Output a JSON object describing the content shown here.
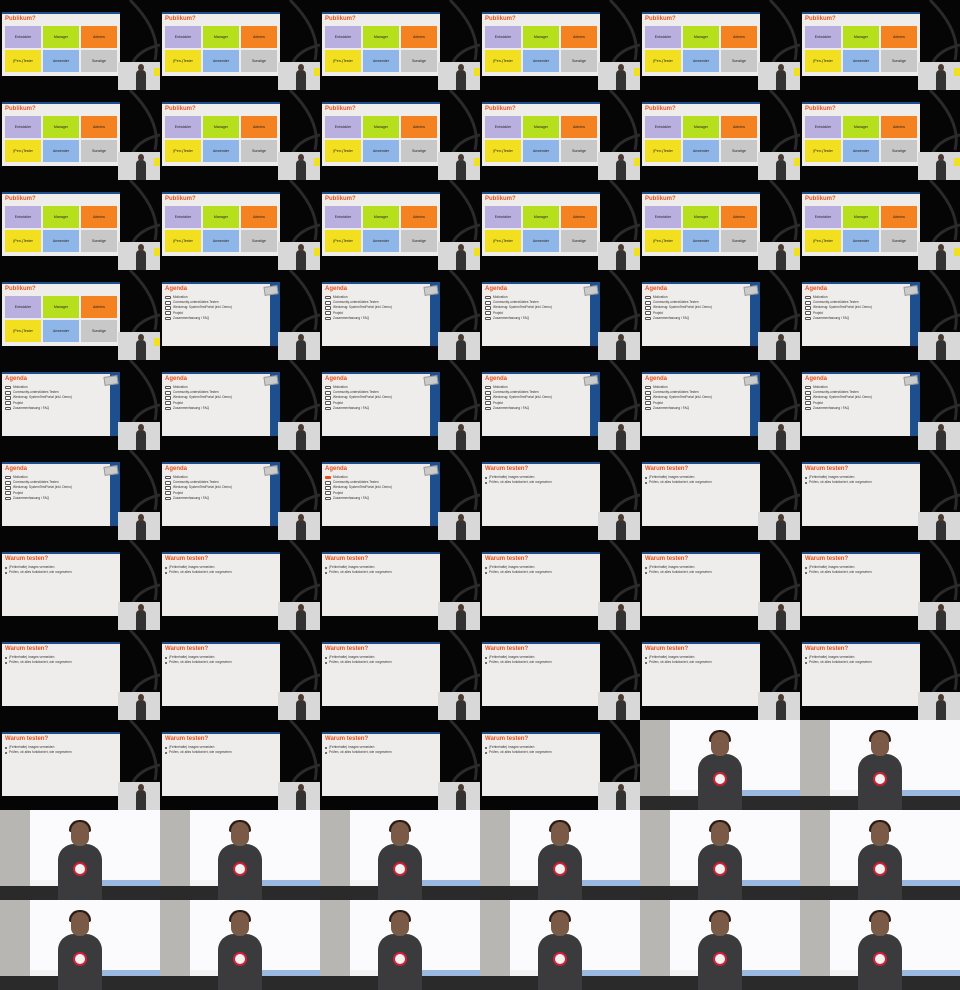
{
  "colors": {
    "accent": "#e8501a",
    "slide_bg": "#eeedeb",
    "brand_blue": "#1c4f8c",
    "tile_entwickler": "#b9b0e0",
    "tile_manager": "#b6e01e",
    "tile_admins": "#f58220",
    "tile_pentester": "#f2e020",
    "tile_anwender": "#8fb6e8",
    "tile_sonstige": "#c8c8c8"
  },
  "slides": {
    "publikum": {
      "title": "Publikum?",
      "tiles": [
        "Entwickler",
        "Manager",
        "Admins",
        "(Pen-)Tester",
        "Anwender",
        "Sonstige"
      ]
    },
    "agenda": {
      "title": "Agenda",
      "items": [
        "Motivation",
        "Community-unterstütztes Testen",
        "Werkzeug: SystemTestPortal (inkl. Demo)",
        "Projekt",
        "Zusammenfassung / FAQ"
      ]
    },
    "warum": {
      "title": "Warum testen?",
      "bullets": [
        "(Fehlerhafte) Images vermeiden",
        "Prüfen, ob alles funktioniert, wie vorgesehen"
      ]
    }
  },
  "frames": [
    "publikum",
    "publikum",
    "publikum",
    "publikum",
    "publikum",
    "publikum",
    "publikum",
    "publikum",
    "publikum",
    "publikum",
    "publikum",
    "publikum",
    "publikum",
    "publikum",
    "publikum",
    "publikum",
    "publikum",
    "publikum",
    "publikum",
    "agenda",
    "agenda",
    "agenda",
    "agenda",
    "agenda",
    "agenda",
    "agenda",
    "agenda",
    "agenda",
    "agenda",
    "agenda",
    "agenda",
    "agenda",
    "agenda-checked",
    "warum",
    "warum",
    "warum",
    "warum",
    "warum",
    "warum",
    "warum",
    "warum",
    "warum",
    "warum",
    "warum",
    "warum",
    "warum",
    "warum",
    "warum",
    "warum",
    "warum",
    "warum",
    "warum",
    "live",
    "live",
    "live",
    "live",
    "live",
    "live",
    "live",
    "live",
    "live",
    "live",
    "live",
    "live",
    "live",
    "live"
  ]
}
